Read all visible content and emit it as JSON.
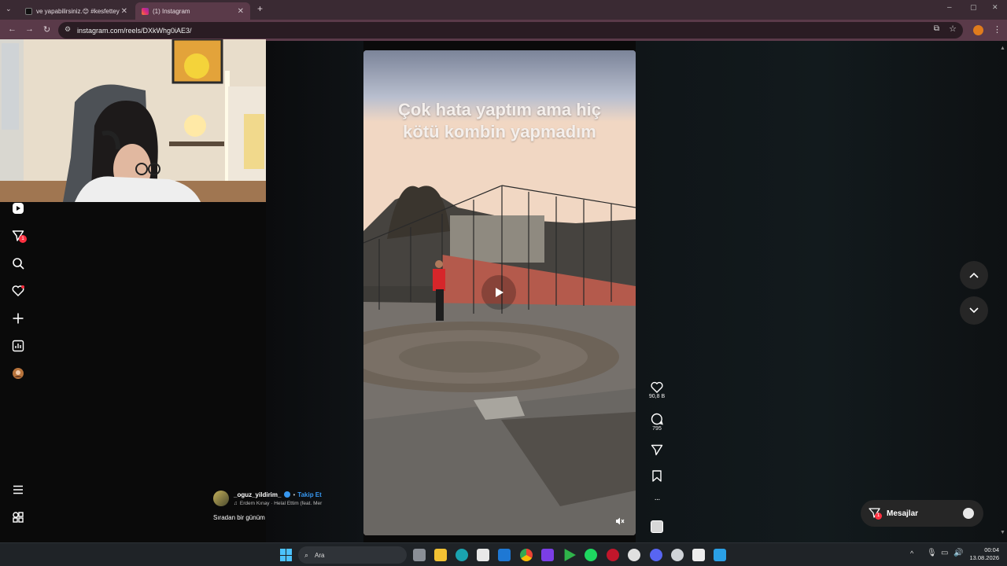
{
  "browser": {
    "tabs": [
      {
        "label": "ve yapabilirsiniz.😊 #kesfettey"
      },
      {
        "label": "(1) Instagram"
      }
    ],
    "new_tab": "+",
    "url": "instagram.com/reels/DXkWhg0iAE3/"
  },
  "sidebar": {
    "notification_badge": "1"
  },
  "reel": {
    "overlay_text_line1": "Çok hata yaptım ama hiç",
    "overlay_text_line2": "kötü kombin yapmadım",
    "author": "_oguz_yildirim_",
    "follow_label": "Takip Et",
    "audio": "Erdem Kınay · Helal Ettim (feat. Mer",
    "caption": "Sıradan bir günüm",
    "likes": "90,8 B",
    "comments": "795",
    "more": "···"
  },
  "messages": {
    "label": "Mesajlar",
    "badge": "1"
  },
  "taskbar": {
    "search_placeholder": "Ara",
    "time": "00:04",
    "date": "13.08.2026"
  },
  "colors": {
    "instagram_blue": "#3797f0",
    "notification_red": "#ff3040"
  }
}
